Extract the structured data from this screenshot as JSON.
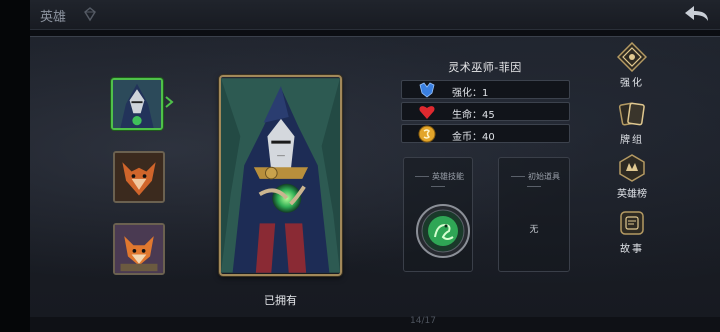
{
  "topbar": {
    "title": "英雄",
    "page_count": "14/17"
  },
  "hero": {
    "name": "灵术巫师-菲因",
    "status": "已拥有",
    "stats": [
      {
        "icon": "blue-crystal-icon",
        "label": "强化：1"
      },
      {
        "icon": "red-heart-icon",
        "label": "生命：45"
      },
      {
        "icon": "gold-coin-icon",
        "label": "金币：40"
      }
    ],
    "skill_box_title": "英雄技能",
    "item_box_title": "初始道具",
    "item_box_value": "无"
  },
  "side_menu": [
    {
      "label": "强化",
      "icon": "upgrade-icon"
    },
    {
      "label": "牌组",
      "icon": "cards-icon"
    },
    {
      "label": "英雄榜",
      "icon": "leaderboard-icon"
    },
    {
      "label": "故事",
      "icon": "story-icon"
    }
  ],
  "colors": {
    "selected_border": "#4fc14a",
    "frame_gold": "#a2895a"
  }
}
